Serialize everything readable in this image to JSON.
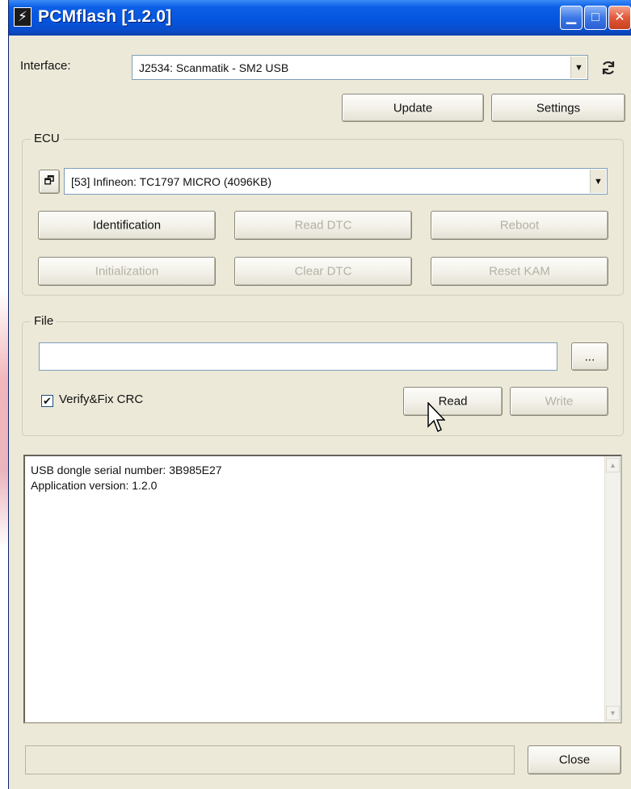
{
  "window": {
    "title": "PCMflash [1.2.0]",
    "app_icon_glyph": "⚡",
    "controls": {
      "minimize": "▁",
      "maximize": "□",
      "close": "✕"
    }
  },
  "interface": {
    "label": "Interface:",
    "selected": "J2534: Scanmatik - SM2 USB",
    "refresh_icon": "refresh-icon"
  },
  "actions": {
    "update": "Update",
    "settings": "Settings"
  },
  "ecu": {
    "group_label": "ECU",
    "selected": "[53] Infineon: TC1797 MICRO (4096KB)",
    "buttons": {
      "identification": "Identification",
      "read_dtc": "Read DTC",
      "reboot": "Reboot",
      "initialization": "Initialization",
      "clear_dtc": "Clear DTC",
      "reset_kam": "Reset KAM"
    }
  },
  "file": {
    "group_label": "File",
    "path_value": "",
    "browse": "...",
    "verify_label": "Verify&Fix CRC",
    "verify_checked": true,
    "read": "Read",
    "write": "Write"
  },
  "log": {
    "lines": [
      "USB dongle serial number: 3B985E27",
      "Application version: 1.2.0"
    ]
  },
  "footer": {
    "close": "Close"
  },
  "colors": {
    "titlebar": "#0454dd",
    "window_bg": "#ece9d8",
    "close_btn": "#e2583b"
  }
}
